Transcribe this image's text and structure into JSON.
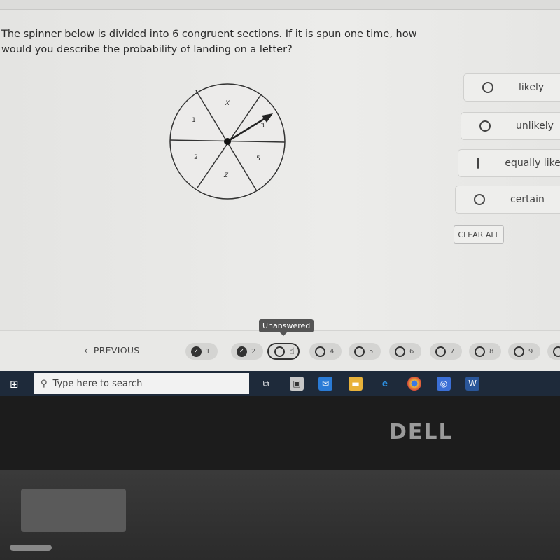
{
  "question": {
    "text": "The spinner below is divided into 6 congruent sections. If it is spun one time, how would you describe the probability of landing on a letter?",
    "spinner_labels": [
      "X",
      "3",
      "5",
      "Z",
      "2",
      "1"
    ]
  },
  "options": [
    {
      "label": "likely"
    },
    {
      "label": "unlikely"
    },
    {
      "label": "equally likely"
    },
    {
      "label": "certain"
    }
  ],
  "clear_all": "CLEAR ALL",
  "nav": {
    "previous": "PREVIOUS",
    "tooltip": "Unanswered",
    "questions": [
      {
        "n": "1",
        "status": "answered"
      },
      {
        "n": "2",
        "status": "answered"
      },
      {
        "n": "3",
        "status": "current"
      },
      {
        "n": "4",
        "status": "unanswered"
      },
      {
        "n": "5",
        "status": "unanswered"
      },
      {
        "n": "6",
        "status": "unanswered"
      },
      {
        "n": "7",
        "status": "unanswered"
      },
      {
        "n": "8",
        "status": "unanswered"
      },
      {
        "n": "9",
        "status": "unanswered"
      }
    ]
  },
  "taskbar": {
    "search_placeholder": "Type here to search"
  },
  "brand": "DELL"
}
